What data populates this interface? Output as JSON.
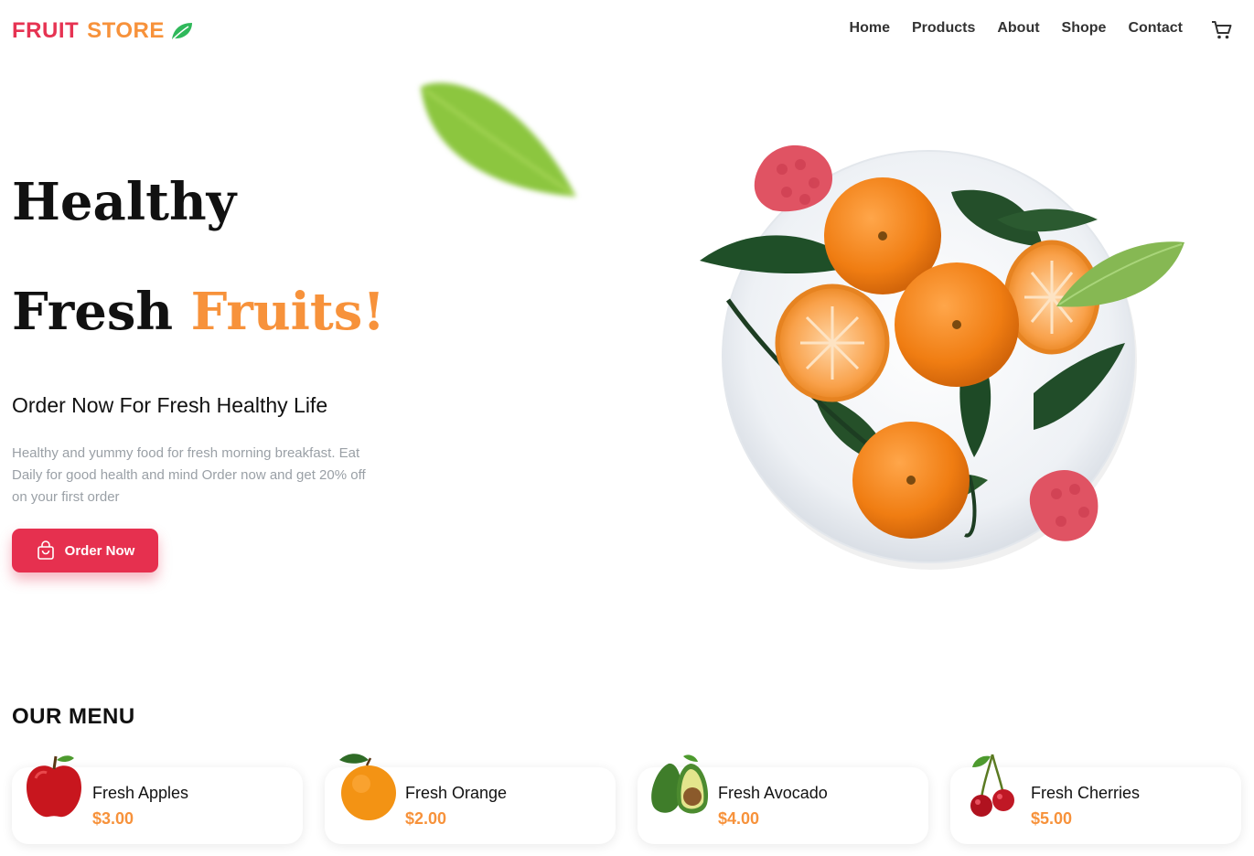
{
  "brand": {
    "word1": "FRUIT",
    "word2": "STORE",
    "leaf_icon": "leaf-icon"
  },
  "nav": {
    "items": [
      "Home",
      "Products",
      "About",
      "Shope",
      "Contact"
    ],
    "cart_icon": "cart-icon"
  },
  "hero": {
    "line1": "Healthy",
    "line2_plain": "Fresh",
    "line2_accent": "Fruits!",
    "tagline": "Order Now For Fresh Healthy Life",
    "description": "Healthy and yummy food for fresh morning breakfast. Eat Daily for good health and mind Order now and get 20% off on your first order",
    "button_label": "Order Now",
    "button_icon": "shopping-bag-icon"
  },
  "menu": {
    "title": "OUR MENU",
    "items": [
      {
        "name": "Fresh Apples",
        "price": "$3.00",
        "icon": "apple-icon"
      },
      {
        "name": "Fresh Orange",
        "price": "$2.00",
        "icon": "orange-icon"
      },
      {
        "name": "Fresh Avocado",
        "price": "$4.00",
        "icon": "avocado-icon"
      },
      {
        "name": "Fresh Cherries",
        "price": "$5.00",
        "icon": "cherries-icon"
      }
    ]
  },
  "colors": {
    "primary": "#e6304f",
    "accent": "#f7923b",
    "leaf": "#2fb85a"
  }
}
